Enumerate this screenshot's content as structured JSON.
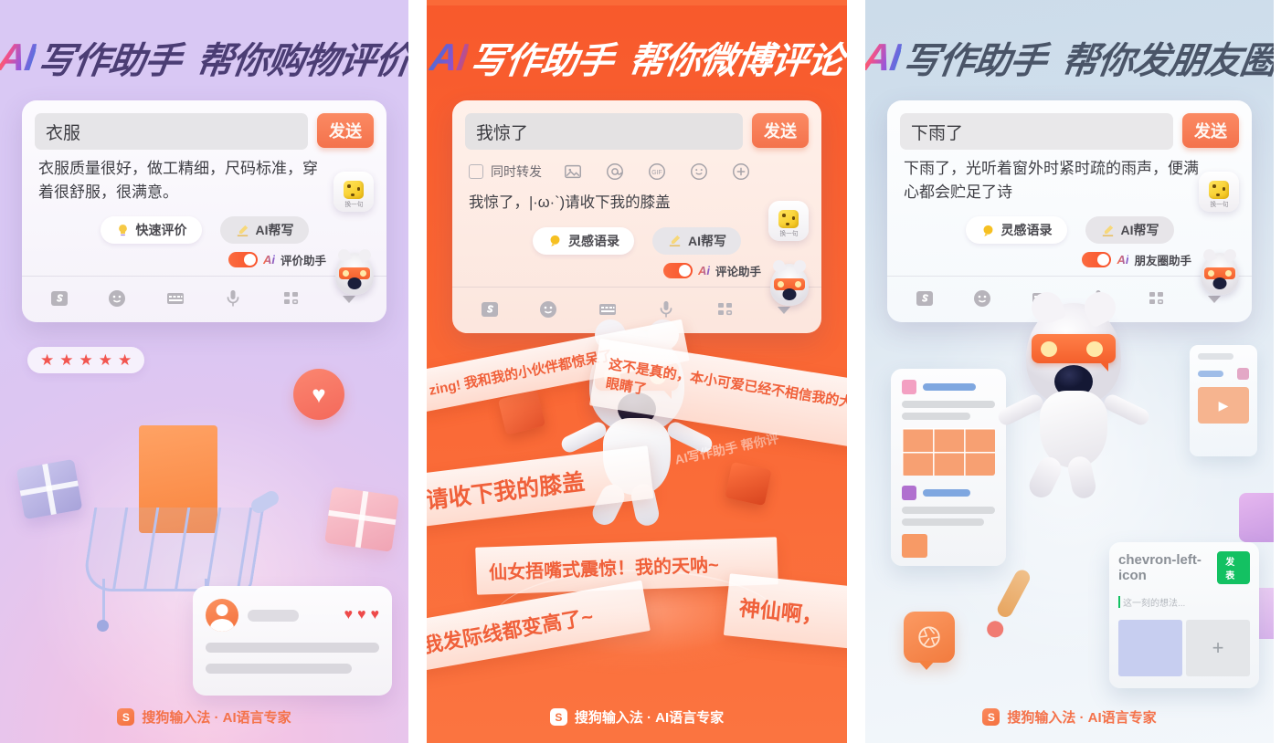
{
  "brand": {
    "logo_text": "S",
    "text": "搜狗输入法 · AI语言专家"
  },
  "panels": [
    {
      "id": "shopping-review",
      "headline": {
        "ai": "AI",
        "main": "写作助手",
        "sub": "帮你购物评价"
      },
      "keyboard": {
        "input_value": "衣服",
        "send_label": "发送",
        "suggestion": "衣服质量很好，做工精细，尺码标准，穿着很舒服，很满意。",
        "dice_label": "换一句",
        "pills": [
          {
            "name": "quick-review",
            "label": "快速评价",
            "icon": "lamp-icon"
          },
          {
            "name": "ai-write",
            "label": "AI帮写",
            "icon": "pen-icon"
          }
        ],
        "toggle": {
          "ai": "Ai",
          "label": "评价助手",
          "on": "true"
        },
        "bar_icons": [
          "sogou-logo-icon",
          "emoji-icon",
          "keyboard-icon",
          "microphone-icon",
          "apps-grid-icon",
          "collapse-arrow-icon"
        ]
      },
      "illustration": {
        "stars": "★★★★★",
        "heart": "♥",
        "review_hearts": "♥♥♥"
      }
    },
    {
      "id": "weibo-comment",
      "headline": {
        "ai": "AI",
        "main": "写作助手",
        "sub": "帮你微博评论"
      },
      "keyboard": {
        "input_value": "我惊了",
        "send_label": "发送",
        "repost_label": "同时转发",
        "icon_row": [
          "image-icon",
          "at-icon",
          "gif-icon",
          "emoji-icon",
          "plus-icon"
        ],
        "suggestion": "我惊了，|·ω·`)请收下我的膝盖",
        "dice_label": "换一句",
        "pills": [
          {
            "name": "inspiration-quotes",
            "label": "灵感语录",
            "icon": "bulb-icon"
          },
          {
            "name": "ai-write",
            "label": "AI帮写",
            "icon": "pen-icon"
          }
        ],
        "toggle": {
          "ai": "Ai",
          "label": "评论助手",
          "on": "true"
        },
        "bar_icons": [
          "sogou-logo-icon",
          "emoji-icon",
          "keyboard-icon",
          "microphone-icon",
          "apps-grid-icon",
          "collapse-arrow-icon"
        ]
      },
      "ribbons": [
        "zing! 我和我的小伙伴都惊呆了",
        "这不是真的，本小可爱已经不相信我的大眼睛了",
        "请收下我的膝盖",
        "仙女捂嘴式震惊！我的天呐~",
        "我发际线都变高了~",
        "神仙啊，",
        "AI写作助手 帮你评"
      ]
    },
    {
      "id": "moments-post",
      "headline": {
        "ai": "AI",
        "main": "写作助手",
        "sub": "帮你发朋友圈"
      },
      "keyboard": {
        "input_value": "下雨了",
        "send_label": "发送",
        "suggestion": "下雨了，光听着窗外时紧时疏的雨声，便满心都会贮足了诗",
        "dice_label": "换一句",
        "pills": [
          {
            "name": "inspiration-quotes",
            "label": "灵感语录",
            "icon": "bulb-icon"
          },
          {
            "name": "ai-write",
            "label": "AI帮写",
            "icon": "pen-icon"
          }
        ],
        "toggle": {
          "ai": "Ai",
          "label": "朋友圈助手",
          "on": "true"
        },
        "bar_icons": [
          "sogou-logo-icon",
          "emoji-icon",
          "keyboard-icon",
          "microphone-icon",
          "apps-grid-icon",
          "collapse-arrow-icon"
        ]
      },
      "moments_card": {
        "back_icon": "chevron-left-icon",
        "publish_label": "发表",
        "placeholder": "这一刻的想法...",
        "add_icon": "+"
      }
    }
  ],
  "colors": {
    "accent_orange": "#f4724a",
    "send_button": "#f87a50",
    "weibo_bg": "#fa6734",
    "headline_purple": "#4b3d74",
    "headline_slate": "#4a5568",
    "toggle_on": "#f9522a",
    "wechat_green": "#13c162"
  }
}
